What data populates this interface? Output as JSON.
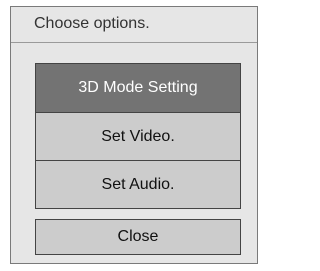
{
  "dialog": {
    "title": "Choose options.",
    "options": [
      {
        "label": "3D Mode Setting",
        "selected": true
      },
      {
        "label": "Set Video.",
        "selected": false
      },
      {
        "label": "Set Audio.",
        "selected": false
      }
    ],
    "close_label": "Close"
  },
  "colors": {
    "background": "#e6e6e6",
    "selected_option": "#737373",
    "option": "#cccccc",
    "border": "#444444"
  }
}
